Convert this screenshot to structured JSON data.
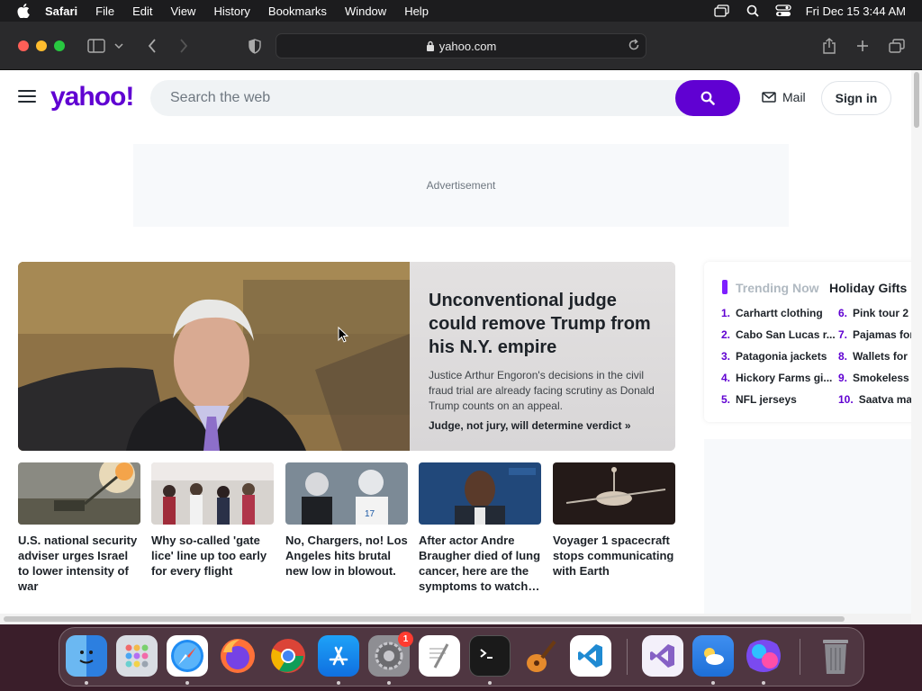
{
  "menubar": {
    "app": "Safari",
    "items": [
      "File",
      "Edit",
      "View",
      "History",
      "Bookmarks",
      "Window",
      "Help"
    ],
    "datetime": "Fri Dec 15  3:44 AM"
  },
  "browser": {
    "url": "yahoo.com"
  },
  "header": {
    "logo": "yahoo!",
    "search_placeholder": "Search the web",
    "mail_label": "Mail",
    "signin_label": "Sign in",
    "brand_color": "#6001d2"
  },
  "ad": {
    "label": "Advertisement"
  },
  "hero": {
    "title": "Unconventional judge could remove Trump from his N.Y. empire",
    "description": "Justice Arthur Engoron's decisions in the civil fraud trial are already facing scrutiny as Donald Trump counts on an appeal.",
    "link": "Judge, not jury, will determine verdict »"
  },
  "stories": [
    {
      "caption": "U.S. national security adviser urges Israel to lower intensity of war"
    },
    {
      "caption": "Why so-called 'gate lice' line up too early for every flight"
    },
    {
      "caption": "No, Chargers, no! Los Angeles hits brutal new low in blowout."
    },
    {
      "caption": "After actor Andre Braugher died of lung cancer, here are the symptoms to watch…"
    },
    {
      "caption": "Voyager 1 spacecraft stops communicating with Earth"
    }
  ],
  "trending": {
    "tab_active": "Trending Now",
    "tab_other": "Holiday Gifts",
    "col1": [
      {
        "n": "1.",
        "label": "Carhartt clothing"
      },
      {
        "n": "2.",
        "label": "Cabo San Lucas r..."
      },
      {
        "n": "3.",
        "label": "Patagonia jackets"
      },
      {
        "n": "4.",
        "label": "Hickory Farms gi..."
      },
      {
        "n": "5.",
        "label": "NFL jerseys"
      }
    ],
    "col2": [
      {
        "n": "6.",
        "label": "Pink tour 2"
      },
      {
        "n": "7.",
        "label": "Pajamas for"
      },
      {
        "n": "8.",
        "label": "Wallets for"
      },
      {
        "n": "9.",
        "label": "Smokeless"
      },
      {
        "n": "10.",
        "label": "Saatva ma"
      }
    ]
  },
  "dock": {
    "apps": [
      "finder-icon",
      "launchpad-icon",
      "safari-icon",
      "firefox-icon",
      "chrome-icon",
      "app-store-icon",
      "system-settings-icon",
      "textedit-icon",
      "terminal-icon",
      "garageband-icon",
      "vscode-icon",
      "visual-studio-icon",
      "weather-icon",
      "gradient-app-icon",
      "trash-icon"
    ],
    "settings_badge": "1"
  }
}
